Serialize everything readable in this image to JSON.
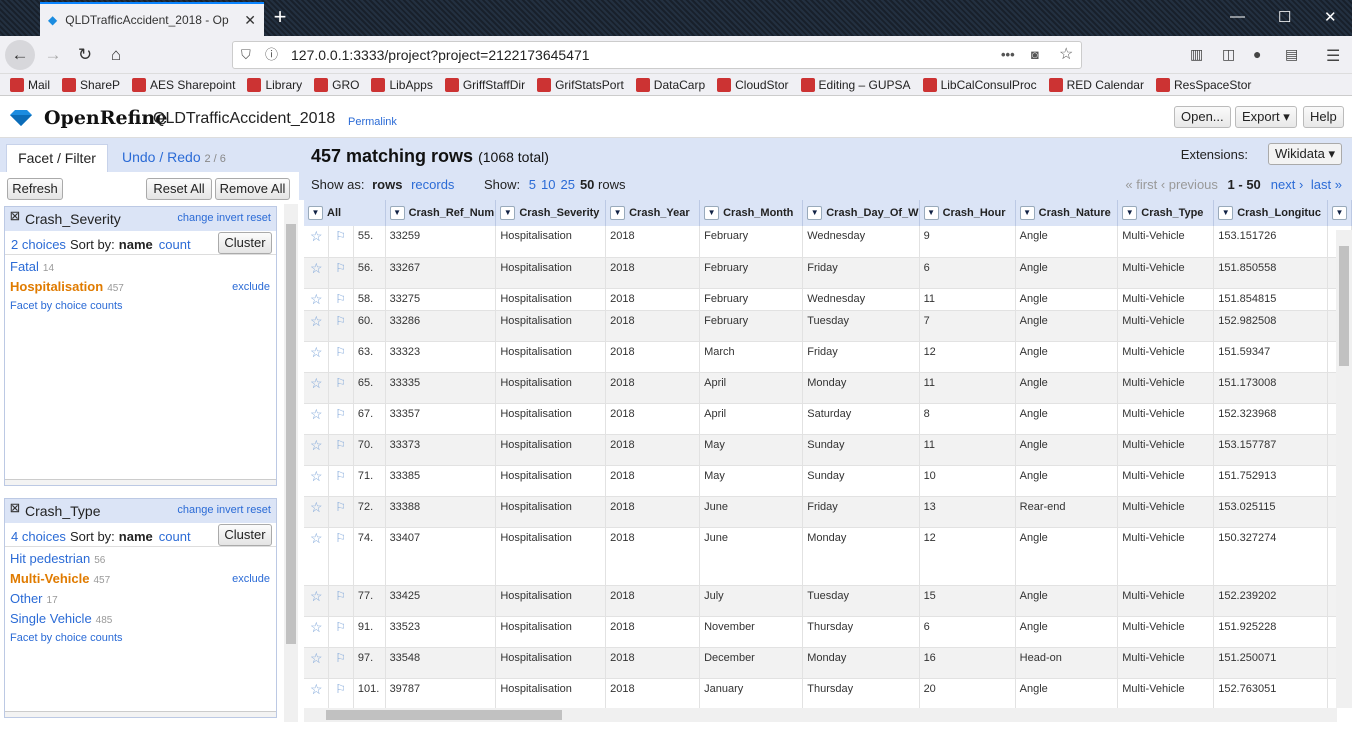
{
  "browser": {
    "tab_title": "QLDTrafficAccident_2018 - Op",
    "url": "127.0.0.1:3333/project?project=2122173645471"
  },
  "bookmarks": [
    "Mail",
    "ShareP",
    "AES Sharepoint",
    "Library",
    "GRO",
    "LibApps",
    "GriffStaffDir",
    "GrifStatsPort",
    "DataCarp",
    "CloudStor",
    "Editing – GUPSA",
    "LibCalConsulProc",
    "RED Calendar",
    "ResSpaceStor"
  ],
  "app": {
    "brand": "OpenRefine",
    "project": "QLDTrafficAccident_2018",
    "permalink": "Permalink",
    "open": "Open...",
    "export": "Export",
    "help": "Help"
  },
  "left": {
    "tab_facet": "Facet / Filter",
    "tab_undo": "Undo / Redo",
    "undo_count": "2 / 6",
    "refresh": "Refresh",
    "reset_all": "Reset All",
    "remove_all": "Remove All"
  },
  "facets": [
    {
      "name": "Crash_Severity",
      "change": "change",
      "invert": "invert",
      "reset": "reset",
      "choices_label": "2 choices",
      "sort_by": "Sort by:",
      "sort_name": "name",
      "sort_count": "count",
      "cluster": "Cluster",
      "items": [
        {
          "name": "Fatal",
          "count": "14",
          "selected": false
        },
        {
          "name": "Hospitalisation",
          "count": "457",
          "selected": true
        }
      ],
      "exclude": "exclude",
      "by_choice": "Facet by choice counts"
    },
    {
      "name": "Crash_Type",
      "change": "change",
      "invert": "invert",
      "reset": "reset",
      "choices_label": "4 choices",
      "sort_by": "Sort by:",
      "sort_name": "name",
      "sort_count": "count",
      "cluster": "Cluster",
      "items": [
        {
          "name": "Hit pedestrian",
          "count": "56",
          "selected": false
        },
        {
          "name": "Multi-Vehicle",
          "count": "457",
          "selected": true
        },
        {
          "name": "Other",
          "count": "17",
          "selected": false
        },
        {
          "name": "Single Vehicle",
          "count": "485",
          "selected": false
        }
      ],
      "exclude": "exclude",
      "by_choice": "Facet by choice counts"
    }
  ],
  "main": {
    "matching": "457 matching rows",
    "total": "(1068 total)",
    "extensions": "Extensions:",
    "wikidata": "Wikidata",
    "show_as": "Show as:",
    "rows": "rows",
    "records": "records",
    "show": "Show:",
    "sizes": [
      "5",
      "10",
      "25",
      "50"
    ],
    "rows_word": "rows",
    "first": "« first",
    "previous": "‹ previous",
    "range": "1 - 50",
    "next": "next ›",
    "last": "last »"
  },
  "columns": [
    "All",
    "Crash_Ref_Num",
    "Crash_Severity",
    "Crash_Year",
    "Crash_Month",
    "Crash_Day_Of_W",
    "Crash_Hour",
    "Crash_Nature",
    "Crash_Type",
    "Crash_Longituc"
  ],
  "rows": [
    [
      "55.",
      "33259",
      "Hospitalisation",
      "2018",
      "February",
      "Wednesday",
      "9",
      "Angle",
      "Multi-Vehicle",
      "153.151726"
    ],
    [
      "56.",
      "33267",
      "Hospitalisation",
      "2018",
      "February",
      "Friday",
      "6",
      "Angle",
      "Multi-Vehicle",
      "151.850558"
    ],
    [
      "58.",
      "33275",
      "Hospitalisation",
      "2018",
      "February",
      "Wednesday",
      "11",
      "Angle",
      "Multi-Vehicle",
      "151.854815"
    ],
    [
      "60.",
      "33286",
      "Hospitalisation",
      "2018",
      "February",
      "Tuesday",
      "7",
      "Angle",
      "Multi-Vehicle",
      "152.982508"
    ],
    [
      "63.",
      "33323",
      "Hospitalisation",
      "2018",
      "March",
      "Friday",
      "12",
      "Angle",
      "Multi-Vehicle",
      "151.59347"
    ],
    [
      "65.",
      "33335",
      "Hospitalisation",
      "2018",
      "April",
      "Monday",
      "11",
      "Angle",
      "Multi-Vehicle",
      "151.173008"
    ],
    [
      "67.",
      "33357",
      "Hospitalisation",
      "2018",
      "April",
      "Saturday",
      "8",
      "Angle",
      "Multi-Vehicle",
      "152.323968"
    ],
    [
      "70.",
      "33373",
      "Hospitalisation",
      "2018",
      "May",
      "Sunday",
      "11",
      "Angle",
      "Multi-Vehicle",
      "153.157787"
    ],
    [
      "71.",
      "33385",
      "Hospitalisation",
      "2018",
      "May",
      "Sunday",
      "10",
      "Angle",
      "Multi-Vehicle",
      "151.752913"
    ],
    [
      "72.",
      "33388",
      "Hospitalisation",
      "2018",
      "June",
      "Friday",
      "13",
      "Rear-end",
      "Multi-Vehicle",
      "153.025115"
    ],
    [
      "74.",
      "33407",
      "Hospitalisation",
      "2018",
      "June",
      "Monday",
      "12",
      "Angle",
      "Multi-Vehicle",
      "150.327274"
    ],
    [
      "77.",
      "33425",
      "Hospitalisation",
      "2018",
      "July",
      "Tuesday",
      "15",
      "Angle",
      "Multi-Vehicle",
      "152.239202"
    ],
    [
      "91.",
      "33523",
      "Hospitalisation",
      "2018",
      "November",
      "Thursday",
      "6",
      "Angle",
      "Multi-Vehicle",
      "151.925228"
    ],
    [
      "97.",
      "33548",
      "Hospitalisation",
      "2018",
      "December",
      "Monday",
      "16",
      "Head-on",
      "Multi-Vehicle",
      "151.250071"
    ],
    [
      "101.",
      "39787",
      "Hospitalisation",
      "2018",
      "January",
      "Thursday",
      "20",
      "Angle",
      "Multi-Vehicle",
      "152.763051"
    ]
  ]
}
